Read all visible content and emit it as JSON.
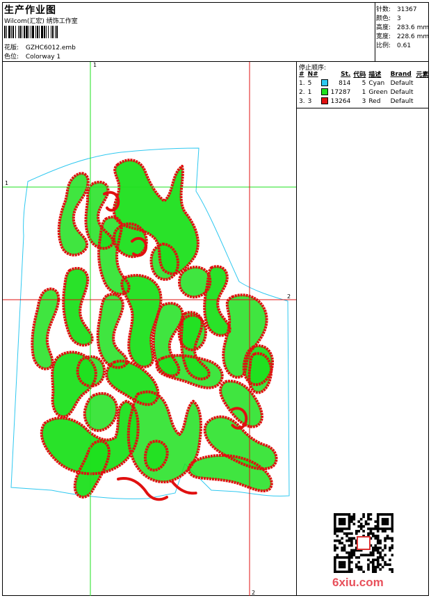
{
  "header": {
    "title": "生产作业图",
    "studio": "Wilcom(汇宏) 绣饰工作室",
    "design_label": "花版:",
    "design_value": "GZHC6012.emb",
    "colorway_label": "色位:",
    "colorway_value": "Colorway 1"
  },
  "stats": [
    {
      "label": "针数:",
      "value": "31367"
    },
    {
      "label": "颜色:",
      "value": "3"
    },
    {
      "label": "高度:",
      "value": "283.6 mm"
    },
    {
      "label": "宽度:",
      "value": "228.6 mm"
    },
    {
      "label": "比例:",
      "value": "0.61"
    }
  ],
  "stops": {
    "title": "停止顺序:",
    "columns": [
      "#",
      "N#",
      "St.",
      "代码",
      "描述",
      "Brand",
      "元素"
    ],
    "rows": [
      {
        "num": "1.",
        "n": "5",
        "color": "#2ec8f0",
        "st": "814",
        "code": "5",
        "desc": "Cyan",
        "brand": "Default"
      },
      {
        "num": "2.",
        "n": "1",
        "color": "#1ee01e",
        "st": "17287",
        "code": "1",
        "desc": "Green",
        "brand": "Default"
      },
      {
        "num": "3.",
        "n": "3",
        "color": "#e01010",
        "st": "13264",
        "code": "3",
        "desc": "Red",
        "brand": "Default"
      }
    ]
  },
  "guides": {
    "green_top": "1",
    "green_left": "1",
    "red_right": "2",
    "red_bottom": "2"
  },
  "colors": {
    "cyan": "#2ec8f0",
    "green": "#1ee01e",
    "red": "#e01010"
  },
  "watermark": "6xiu.com"
}
